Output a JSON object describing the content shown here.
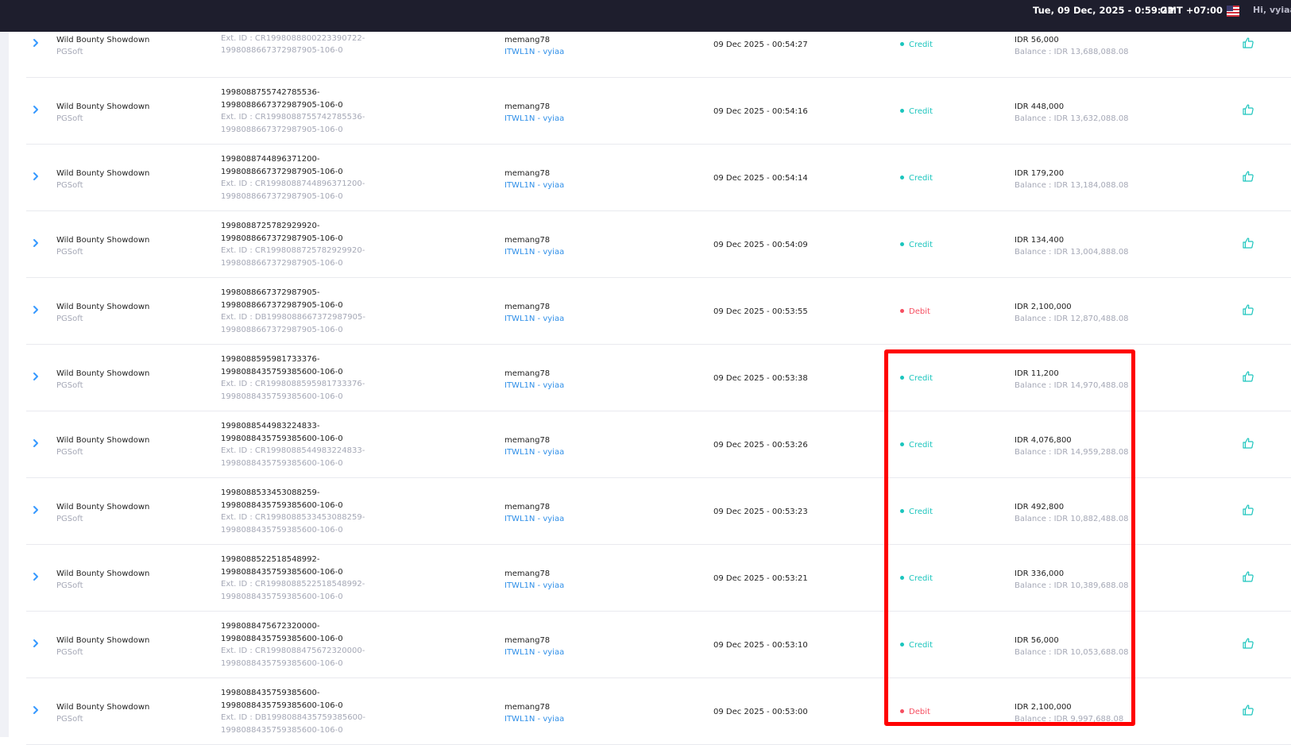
{
  "topbar": {
    "datetime": "Tue, 09 Dec, 2025 - 0:59:22",
    "timezone": "GMT +07:00",
    "greeting": "Hi, vyiaa"
  },
  "colors": {
    "topbar_bg": "#1e1e2d",
    "credit": "#1bc5bd",
    "debit": "#f64e60",
    "link": "#2f8fe8",
    "highlight": "#ff0000"
  },
  "rows": [
    {
      "game": "Wild Bounty Showdown",
      "provider": "PGSoft",
      "tx_line1": "",
      "tx_line2": "1998088667372987905-106-0",
      "ext_line1": "Ext. ID : CR1998088800223390722-",
      "ext_line2": "1998088667372987905-106-0",
      "user": "memang78",
      "agent": "ITWL1N - vyiaa",
      "time": "09 Dec 2025 - 00:54:27",
      "type": "Credit",
      "kind": "credit",
      "amount": "IDR 56,000",
      "balance": "Balance : IDR 13,688,088.08"
    },
    {
      "game": "Wild Bounty Showdown",
      "provider": "PGSoft",
      "tx_line1": "1998088755742785536-",
      "tx_line2": "1998088667372987905-106-0",
      "ext_line1": "Ext. ID : CR1998088755742785536-",
      "ext_line2": "1998088667372987905-106-0",
      "user": "memang78",
      "agent": "ITWL1N - vyiaa",
      "time": "09 Dec 2025 - 00:54:16",
      "type": "Credit",
      "kind": "credit",
      "amount": "IDR 448,000",
      "balance": "Balance : IDR 13,632,088.08"
    },
    {
      "game": "Wild Bounty Showdown",
      "provider": "PGSoft",
      "tx_line1": "1998088744896371200-",
      "tx_line2": "1998088667372987905-106-0",
      "ext_line1": "Ext. ID : CR1998088744896371200-",
      "ext_line2": "1998088667372987905-106-0",
      "user": "memang78",
      "agent": "ITWL1N - vyiaa",
      "time": "09 Dec 2025 - 00:54:14",
      "type": "Credit",
      "kind": "credit",
      "amount": "IDR 179,200",
      "balance": "Balance : IDR 13,184,088.08"
    },
    {
      "game": "Wild Bounty Showdown",
      "provider": "PGSoft",
      "tx_line1": "1998088725782929920-",
      "tx_line2": "1998088667372987905-106-0",
      "ext_line1": "Ext. ID : CR1998088725782929920-",
      "ext_line2": "1998088667372987905-106-0",
      "user": "memang78",
      "agent": "ITWL1N - vyiaa",
      "time": "09 Dec 2025 - 00:54:09",
      "type": "Credit",
      "kind": "credit",
      "amount": "IDR 134,400",
      "balance": "Balance : IDR 13,004,888.08"
    },
    {
      "game": "Wild Bounty Showdown",
      "provider": "PGSoft",
      "tx_line1": "1998088667372987905-",
      "tx_line2": "1998088667372987905-106-0",
      "ext_line1": "Ext. ID : DB1998088667372987905-",
      "ext_line2": "1998088667372987905-106-0",
      "user": "memang78",
      "agent": "ITWL1N - vyiaa",
      "time": "09 Dec 2025 - 00:53:55",
      "type": "Debit",
      "kind": "debit",
      "amount": "IDR 2,100,000",
      "balance": "Balance : IDR 12,870,488.08"
    },
    {
      "game": "Wild Bounty Showdown",
      "provider": "PGSoft",
      "tx_line1": "1998088595981733376-",
      "tx_line2": "1998088435759385600-106-0",
      "ext_line1": "Ext. ID : CR1998088595981733376-",
      "ext_line2": "1998088435759385600-106-0",
      "user": "memang78",
      "agent": "ITWL1N - vyiaa",
      "time": "09 Dec 2025 - 00:53:38",
      "type": "Credit",
      "kind": "credit",
      "amount": "IDR 11,200",
      "balance": "Balance : IDR 14,970,488.08"
    },
    {
      "game": "Wild Bounty Showdown",
      "provider": "PGSoft",
      "tx_line1": "1998088544983224833-",
      "tx_line2": "1998088435759385600-106-0",
      "ext_line1": "Ext. ID : CR1998088544983224833-",
      "ext_line2": "1998088435759385600-106-0",
      "user": "memang78",
      "agent": "ITWL1N - vyiaa",
      "time": "09 Dec 2025 - 00:53:26",
      "type": "Credit",
      "kind": "credit",
      "amount": "IDR 4,076,800",
      "balance": "Balance : IDR 14,959,288.08"
    },
    {
      "game": "Wild Bounty Showdown",
      "provider": "PGSoft",
      "tx_line1": "1998088533453088259-",
      "tx_line2": "1998088435759385600-106-0",
      "ext_line1": "Ext. ID : CR1998088533453088259-",
      "ext_line2": "1998088435759385600-106-0",
      "user": "memang78",
      "agent": "ITWL1N - vyiaa",
      "time": "09 Dec 2025 - 00:53:23",
      "type": "Credit",
      "kind": "credit",
      "amount": "IDR 492,800",
      "balance": "Balance : IDR 10,882,488.08"
    },
    {
      "game": "Wild Bounty Showdown",
      "provider": "PGSoft",
      "tx_line1": "1998088522518548992-",
      "tx_line2": "1998088435759385600-106-0",
      "ext_line1": "Ext. ID : CR1998088522518548992-",
      "ext_line2": "1998088435759385600-106-0",
      "user": "memang78",
      "agent": "ITWL1N - vyiaa",
      "time": "09 Dec 2025 - 00:53:21",
      "type": "Credit",
      "kind": "credit",
      "amount": "IDR 336,000",
      "balance": "Balance : IDR 10,389,688.08"
    },
    {
      "game": "Wild Bounty Showdown",
      "provider": "PGSoft",
      "tx_line1": "1998088475672320000-",
      "tx_line2": "1998088435759385600-106-0",
      "ext_line1": "Ext. ID : CR1998088475672320000-",
      "ext_line2": "1998088435759385600-106-0",
      "user": "memang78",
      "agent": "ITWL1N - vyiaa",
      "time": "09 Dec 2025 - 00:53:10",
      "type": "Credit",
      "kind": "credit",
      "amount": "IDR 56,000",
      "balance": "Balance : IDR 10,053,688.08"
    },
    {
      "game": "Wild Bounty Showdown",
      "provider": "PGSoft",
      "tx_line1": "1998088435759385600-",
      "tx_line2": "1998088435759385600-106-0",
      "ext_line1": "Ext. ID : DB1998088435759385600-",
      "ext_line2": "1998088435759385600-106-0",
      "user": "memang78",
      "agent": "ITWL1N - vyiaa",
      "time": "09 Dec 2025 - 00:53:00",
      "type": "Debit",
      "kind": "debit",
      "amount": "IDR 2,100,000",
      "balance": "Balance : IDR 9,997,688.08"
    }
  ]
}
